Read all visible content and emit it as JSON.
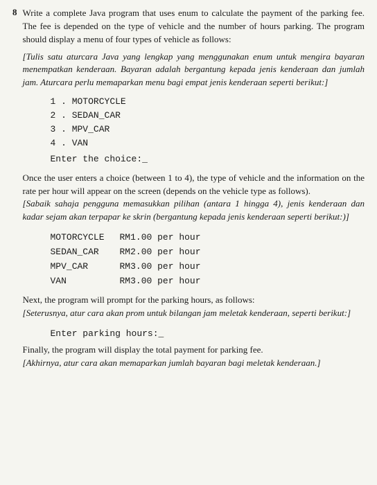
{
  "question": {
    "number": "8",
    "english_text": "Write a complete Java program that uses enum to calculate the payment of the parking fee. The fee is depended on the type of vehicle and the number of hours parking. The program should display a menu of four types of vehicle as follows:",
    "malay_text": "Tulis satu aturcara Java yang lengkap yang menggunakan enum untuk mengira bayaran menempatkan kenderaan. Bayaran adalah bergantung kepada jenis kenderaan dan jumlah jam. Aturcara perlu memaparkan menu bagi empat jenis kenderaan seperti berikut:",
    "menu_items": [
      "1 . MOTORCYCLE",
      "2 . SEDAN_CAR",
      "3 . MPV_CAR",
      "4 . VAN"
    ],
    "prompt_choice": "Enter the choice:_",
    "section2_en": "Once the user enters a choice (between 1 to 4), the type of vehicle and the information on the rate per hour will appear on the screen (depends on the vehicle type as follows).",
    "section2_my": "Sabaik sahaja pengguna memasukkan pilihan (antara 1 hingga 4), jenis kenderaan dan kadar sejam akan terpapar ke skrin (bergantung kepada jenis kenderaan seperti berikut:)",
    "rates": [
      {
        "vehicle": "MOTORCYCLE",
        "rate": "RM1.00 per hour"
      },
      {
        "vehicle": "SEDAN CAR",
        "rate": "RM2.00 per hour"
      },
      {
        "vehicle": "MPV_CAR",
        "rate": "RM3.00 per hour"
      },
      {
        "vehicle": "VAN",
        "rate": "RM3.00 per hour"
      }
    ],
    "section3_en": "Next, the program will prompt for the parking hours, as follows:",
    "section3_my": "Seterusnya, atur cara akan prom untuk bilangan jam meletak kenderaan, seperti berikut:",
    "prompt_parking": "Enter parking hours:_",
    "section4_en": "Finally, the program will display the total payment for parking fee.",
    "section4_my": "Akhirnya, atur cara akan memaparkan jumlah bayaran bagi meletak kenderaan."
  }
}
